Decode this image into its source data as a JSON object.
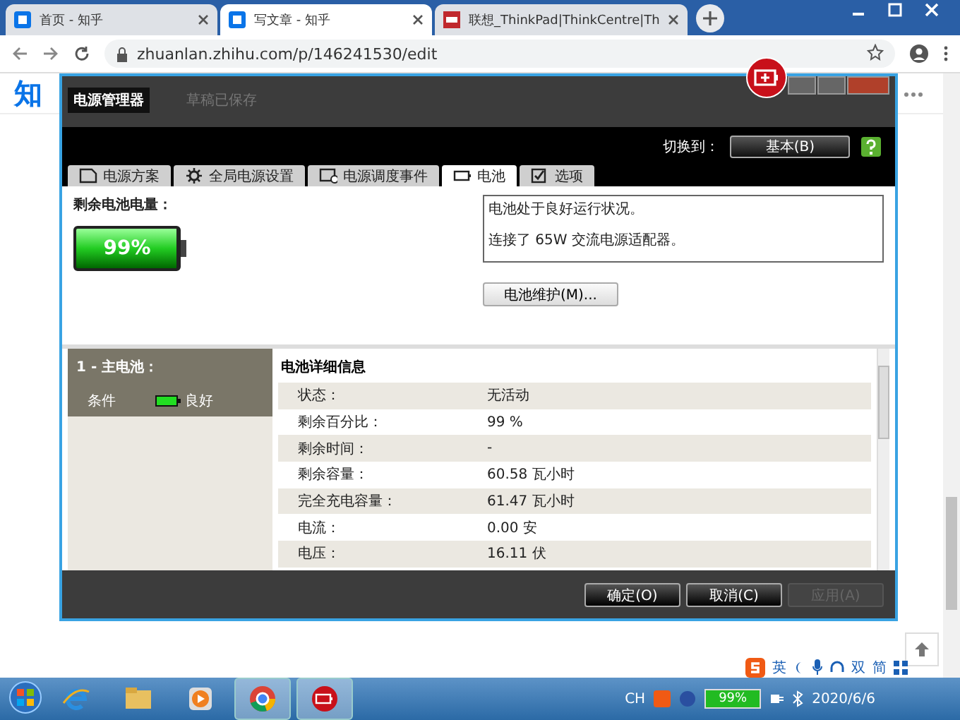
{
  "browser": {
    "tabs": [
      {
        "title": "首页 - 知乎",
        "selected": false
      },
      {
        "title": "写文章 - 知乎",
        "selected": true
      },
      {
        "title": "联想_ThinkPad|ThinkCentre|Th",
        "selected": false
      }
    ],
    "url": "zhuanlan.zhihu.com/p/146241530/edit"
  },
  "page": {
    "logo": "知",
    "draft_status": "草稿已保存"
  },
  "dialog": {
    "title": "电源管理器",
    "switch_label": "切换到：",
    "switch_button": "基本(B)",
    "tabs": [
      {
        "label": "电源方案",
        "kind": "plan",
        "selected": false
      },
      {
        "label": "全局电源设置",
        "kind": "gear",
        "selected": false
      },
      {
        "label": "电源调度事件",
        "kind": "event",
        "selected": false
      },
      {
        "label": "电池",
        "kind": "battery",
        "selected": true
      },
      {
        "label": "选项",
        "kind": "check",
        "selected": false
      }
    ],
    "remaining_label": "剩余电池电量：",
    "battery": {
      "level": 0.99,
      "reading": "99%"
    },
    "status_lines": [
      "电池处于良好运行状况。",
      "连接了 65W 交流电源适配器。"
    ],
    "maintenance_button": "电池维护(M)...",
    "battery_list": {
      "title": "1 - 主电池：",
      "condition_label": "条件",
      "condition": "良好"
    },
    "details": {
      "title": "电池详细信息",
      "rows": [
        {
          "label": "状态：",
          "value": "无活动"
        },
        {
          "label": "剩余百分比：",
          "value": "99 %"
        },
        {
          "label": "剩余时间：",
          "value": "-"
        },
        {
          "label": "剩余容量：",
          "value": "60.58 瓦小时"
        },
        {
          "label": "完全充电容量：",
          "value": "61.47 瓦小时"
        },
        {
          "label": "电流：",
          "value": "0.00 安"
        },
        {
          "label": "电压：",
          "value": "16.11 伏"
        }
      ]
    },
    "buttons": [
      {
        "label": "确定(O)",
        "disabled": false
      },
      {
        "label": "取消(C)",
        "disabled": false
      },
      {
        "label": "应用(A)",
        "disabled": true
      }
    ]
  },
  "ime_bar": {
    "items": [
      "英",
      "双",
      "简"
    ]
  },
  "taskbar": {
    "apps": [
      {
        "kind": "ie",
        "active": false
      },
      {
        "kind": "folder",
        "active": false
      },
      {
        "kind": "media",
        "active": false
      },
      {
        "kind": "chrome",
        "active": true
      },
      {
        "kind": "battery",
        "active": true
      }
    ],
    "language": "CH",
    "battery": {
      "level": 0.99,
      "reading": "99%"
    },
    "date": "2020/6/6"
  }
}
